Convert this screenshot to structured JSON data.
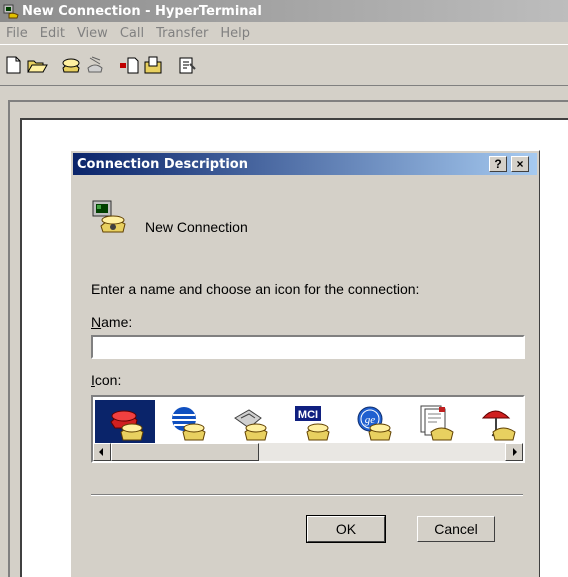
{
  "window": {
    "title": "New Connection - HyperTerminal"
  },
  "menu": [
    "File",
    "Edit",
    "View",
    "Call",
    "Transfer",
    "Help"
  ],
  "toolbar": {
    "buttons": [
      "new-icon",
      "open-icon",
      "connect-icon",
      "disconnect-icon",
      "send-icon",
      "receive-icon",
      "properties-icon"
    ]
  },
  "dialog": {
    "title": "Connection Description",
    "help_button": "?",
    "close_button": "×",
    "connection_name": "New Connection",
    "prompt": "Enter a name and choose an icon for the connection:",
    "name_label_mnemonic": "N",
    "name_label_rest": "ame:",
    "name_value": "",
    "icon_label_mnemonic": "I",
    "icon_label_rest": "con:",
    "icons": [
      "red-phone-icon",
      "globe-phone-icon",
      "fax-phone-icon",
      "mci-phone-icon",
      "ge-phone-icon",
      "document-phone-icon",
      "umbrella-phone-icon"
    ],
    "selected_icon_index": 0,
    "ok_label": "OK",
    "cancel_label": "Cancel"
  }
}
